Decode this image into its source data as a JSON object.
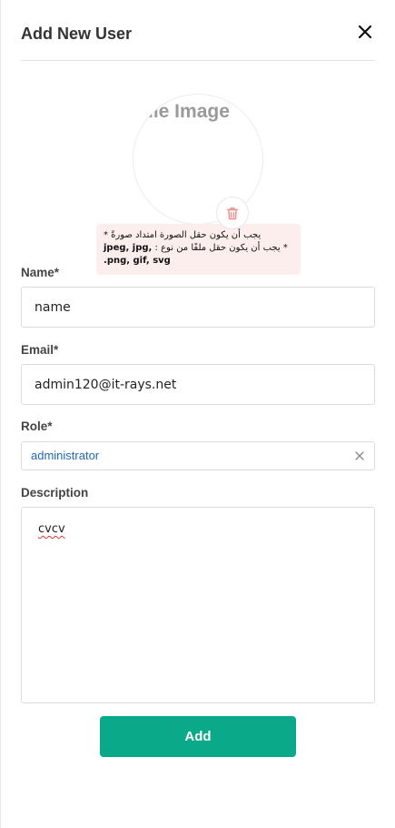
{
  "modal": {
    "title": "Add New User",
    "close_icon": "close-icon"
  },
  "avatar": {
    "placeholder_text": "Profile Image",
    "trash_icon": "trash-icon",
    "trash_color": "#f08c8c"
  },
  "errors": {
    "line1": "يجب أن يكون حقل الصورة امتداد صورةً *",
    "line2_prefix": "* يجب أن يكون حقل ملفًا من نوع :",
    "line2_types": "jpeg, jpg, png, gif, svg."
  },
  "form": {
    "name": {
      "label": "Name*",
      "value": "name"
    },
    "email": {
      "label": "Email*",
      "value": "admin120@it-rays.net"
    },
    "role": {
      "label": "Role*",
      "value": "administrator",
      "clear_icon": "clear-icon"
    },
    "description": {
      "label": "Description",
      "value": "cvcv"
    }
  },
  "actions": {
    "add_label": "Add",
    "add_color": "#0aa98a"
  }
}
